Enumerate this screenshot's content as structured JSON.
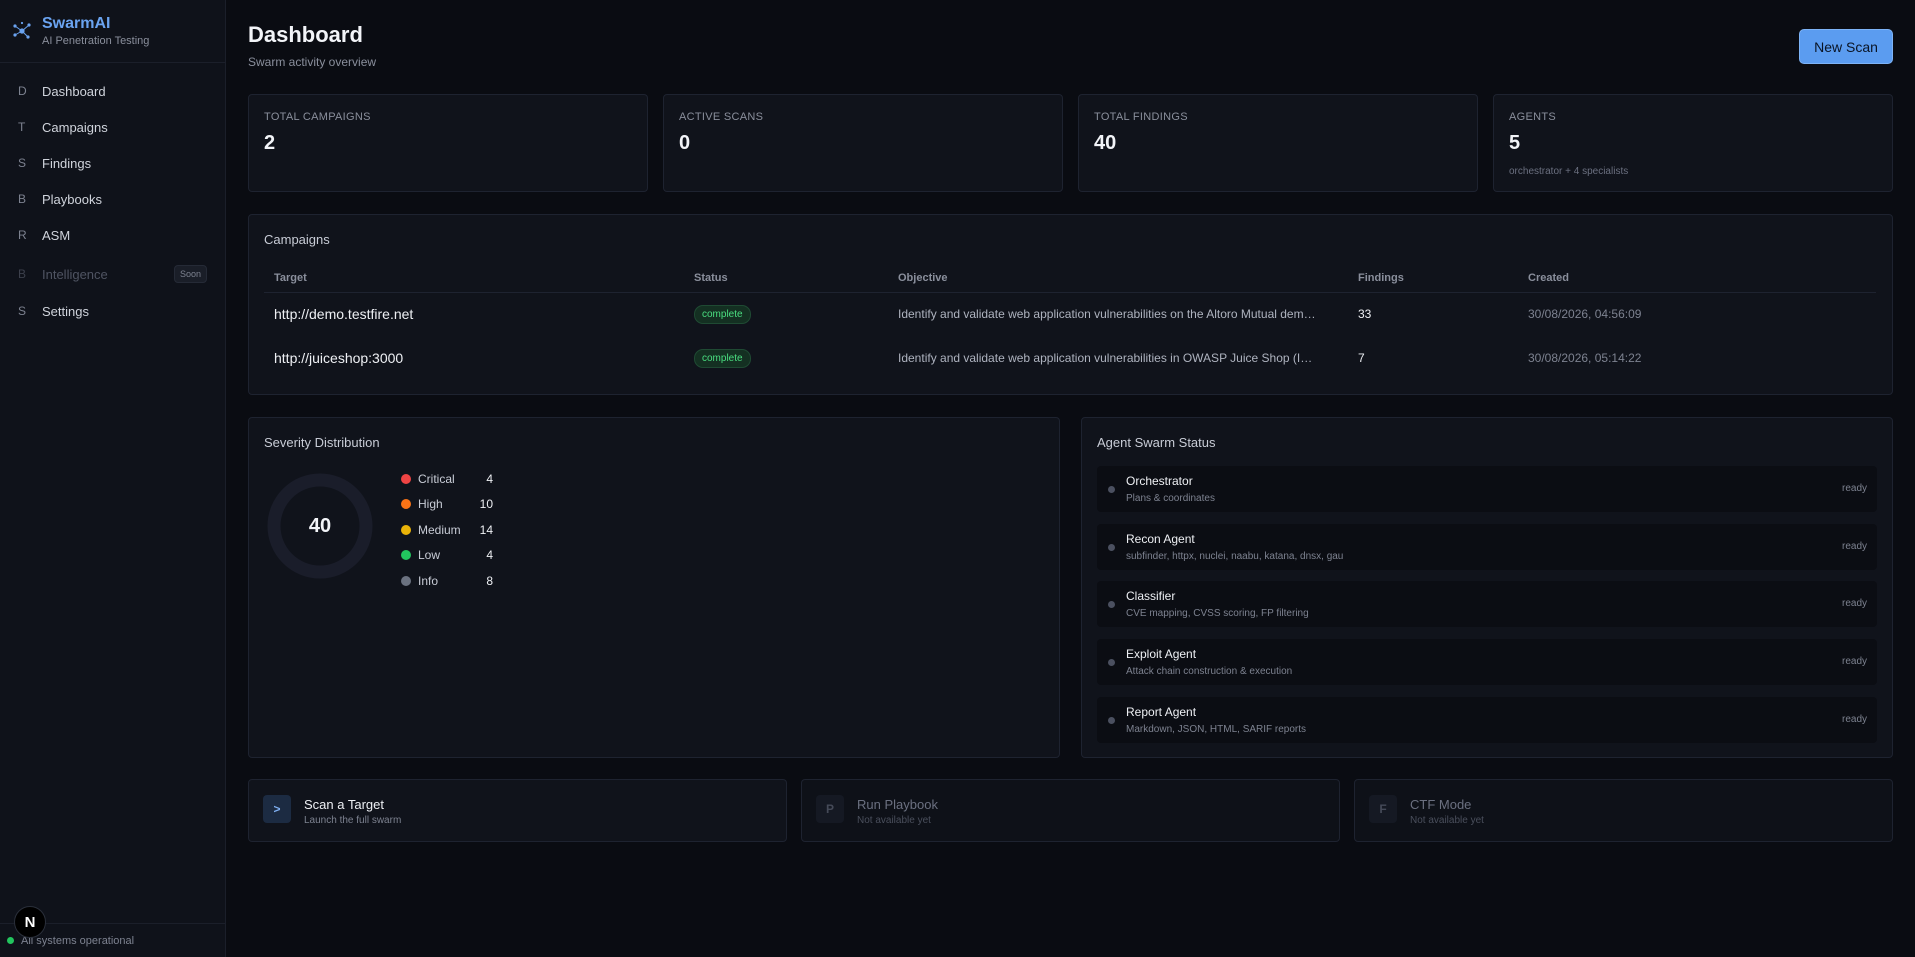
{
  "brand": {
    "name": "SwarmAI",
    "subtitle": "AI Penetration Testing"
  },
  "nav": [
    {
      "letter": "D",
      "label": "Dashboard"
    },
    {
      "letter": "T",
      "label": "Campaigns"
    },
    {
      "letter": "S",
      "label": "Findings"
    },
    {
      "letter": "B",
      "label": "Playbooks"
    },
    {
      "letter": "R",
      "label": "ASM"
    },
    {
      "letter": "B",
      "label": "Intelligence",
      "badge": "Soon"
    },
    {
      "letter": "S",
      "label": "Settings"
    }
  ],
  "system_status": "All systems operational",
  "n_badge": "N",
  "header": {
    "title": "Dashboard",
    "subtitle": "Swarm activity overview",
    "new_scan": "New Scan"
  },
  "stats": [
    {
      "label": "TOTAL CAMPAIGNS",
      "value": "2"
    },
    {
      "label": "ACTIVE SCANS",
      "value": "0"
    },
    {
      "label": "TOTAL FINDINGS",
      "value": "40"
    },
    {
      "label": "AGENTS",
      "value": "5",
      "sub": "orchestrator + 4 specialists"
    }
  ],
  "campaigns": {
    "title": "Campaigns",
    "columns": [
      "Target",
      "Status",
      "Objective",
      "Findings",
      "Created"
    ],
    "rows": [
      {
        "target": "http://demo.testfire.net",
        "status": "complete",
        "objective": "Identify and validate web application vulnerabilities on the Altoro Mutual dem…",
        "findings": "33",
        "created": "30/08/2026, 04:56:09"
      },
      {
        "target": "http://juiceshop:3000",
        "status": "complete",
        "objective": "Identify and validate web application vulnerabilities in OWASP Juice Shop (I…",
        "findings": "7",
        "created": "30/08/2026, 05:14:22"
      }
    ]
  },
  "severity": {
    "title": "Severity Distribution",
    "total": "40",
    "items": [
      {
        "name": "Critical",
        "count": "4",
        "color": "#ef4444"
      },
      {
        "name": "High",
        "count": "10",
        "color": "#f97316"
      },
      {
        "name": "Medium",
        "count": "14",
        "color": "#eab308"
      },
      {
        "name": "Low",
        "count": "4",
        "color": "#22c55e"
      },
      {
        "name": "Info",
        "count": "8",
        "color": "#6b7280"
      }
    ]
  },
  "agents": {
    "title": "Agent Swarm Status",
    "items": [
      {
        "name": "Orchestrator",
        "desc": "Plans & coordinates",
        "state": "ready"
      },
      {
        "name": "Recon Agent",
        "desc": "subfinder, httpx, nuclei, naabu, katana, dnsx, gau",
        "state": "ready"
      },
      {
        "name": "Classifier",
        "desc": "CVE mapping, CVSS scoring, FP filtering",
        "state": "ready"
      },
      {
        "name": "Exploit Agent",
        "desc": "Attack chain construction & execution",
        "state": "ready"
      },
      {
        "name": "Report Agent",
        "desc": "Markdown, JSON, HTML, SARIF reports",
        "state": "ready"
      }
    ]
  },
  "actions": [
    {
      "icon": ">",
      "title": "Scan a Target",
      "sub": "Launch the full swarm"
    },
    {
      "icon": "P",
      "title": "Run Playbook",
      "sub": "Not available yet"
    },
    {
      "icon": "F",
      "title": "CTF Mode",
      "sub": "Not available yet"
    }
  ]
}
